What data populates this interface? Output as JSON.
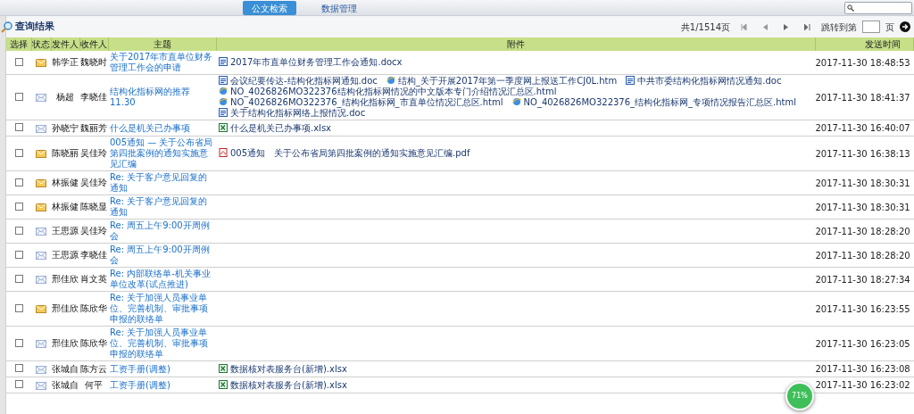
{
  "tabs": [
    {
      "label": "公文检索",
      "selected": true
    },
    {
      "label": "数据管理",
      "selected": false
    }
  ],
  "title": "查询结果",
  "pager": {
    "info": "共1/1514页",
    "jump_label": "跳转到第",
    "page_suffix": "页"
  },
  "table": {
    "columns": [
      "选择",
      "状态",
      "发件人",
      "收件人",
      "主题",
      "附件",
      "发送时间"
    ],
    "rows": [
      {
        "checked": false,
        "unread": true,
        "sender": "韩学正",
        "recipient": "魏晓时",
        "subject": "关于2017年市直单位财务管理工作会的申请",
        "attachments": [
          {
            "kind": "word",
            "name": "2017年市直单位财务管理工作会通知",
            "ext": ".docx"
          }
        ],
        "time": "2017-11-30 18:48:53"
      },
      {
        "checked": false,
        "unread": false,
        "sender": "杨超",
        "recipient": "李晓佳",
        "subject": "结构化指标网的推荐",
        "subject_suffix": "11.30",
        "attachments": [
          {
            "kind": "word",
            "name": "会议纪要传达-结构化指标网通知",
            "ext": ".doc"
          },
          {
            "kind": "web",
            "name": "结构_关于开展2017年第一季度网上报送工作CJ0L",
            "ext": ".htm"
          },
          {
            "kind": "word",
            "name": "中共市委结构化指标网情况通知",
            "ext": ".doc"
          },
          {
            "kind": "web",
            "name": "NO_4026826MO322376结构化指标网情况的中文版本专门介绍情况汇总区",
            "ext": ".html"
          },
          {
            "kind": "web",
            "name": "NO_4026826MO322376_结构化指标网_市直单位情况汇总区",
            "ext": ".html"
          },
          {
            "kind": "web",
            "name": "NO_4026826MO322376_结构化指标网_专项情况报告汇总区",
            "ext": ".html"
          },
          {
            "kind": "word",
            "name": "关于结构化指标网络上报情况",
            "ext": ".doc"
          }
        ],
        "time": "2017-11-30 18:41:37"
      },
      {
        "checked": false,
        "unread": false,
        "sender": "孙晓宁",
        "recipient": "魏丽芳",
        "subject": "什么是机关已办事项",
        "attachments": [
          {
            "kind": "excel",
            "name": "什么是机关已办事项",
            "ext": ".xlsx"
          }
        ],
        "time": "2017-11-30 16:40:07"
      },
      {
        "checked": false,
        "unread": true,
        "sender": "陈晓丽",
        "recipient": "吴佳玲",
        "subject": "005通知 — 关于公布省局第四批案例的通知实施意见汇编",
        "attachments": [
          {
            "kind": "pdf",
            "name": "005通知"
          },
          {
            "kind": "plain",
            "name": "关于公布省局第四批案例的通知实施意见汇编",
            "ext": ".pdf"
          }
        ],
        "time": "2017-11-30 16:38:13"
      },
      {
        "checked": false,
        "unread": true,
        "sender": "林振健",
        "recipient": "吴佳玲",
        "subject_prefix": "Re:",
        "subject": "关于客户意见回复的通知",
        "attachments": [],
        "time": "2017-11-30 18:30:31"
      },
      {
        "checked": false,
        "unread": true,
        "sender": "林振健",
        "recipient": "陈晓显",
        "subject_prefix": "Re:",
        "subject": "关于客户意见回复的通知",
        "attachments": [],
        "time": "2017-11-30 18:30:31"
      },
      {
        "checked": false,
        "unread": false,
        "sender": "王思源",
        "recipient": "吴佳玲",
        "subject_prefix": "Re:",
        "subject": "周五上午9:00开周例会",
        "attachments": [],
        "time": "2017-11-30 18:28:20"
      },
      {
        "checked": false,
        "unread": false,
        "sender": "王思源",
        "recipient": "李晓佳",
        "subject_prefix": "Re:",
        "subject": "周五上午9:00开周例会",
        "attachments": [],
        "time": "2017-11-30 18:28:20"
      },
      {
        "checked": false,
        "unread": false,
        "sender": "邢佳欣",
        "recipient": "肖文英",
        "subject_prefix": "Re:",
        "subject": "内部联络单-机关事业单位改革(试点推进)",
        "attachments": [],
        "time": "2017-11-30 18:27:34"
      },
      {
        "checked": false,
        "unread": true,
        "sender": "邢佳欣",
        "recipient": "陈欣华",
        "subject_prefix": "Re:",
        "subject": "关于加强人员事业单位、完善机制、审批事项申报的联络单",
        "attachments": [],
        "time": "2017-11-30 16:23:55"
      },
      {
        "checked": false,
        "unread": false,
        "sender": "邢佳欣",
        "recipient": "陈欣华",
        "subject_prefix": "Re:",
        "subject": "关于加强人员事业单位、完善机制、审批事项申报的联络单",
        "attachments": [],
        "time": "2017-11-30 16:23:05"
      },
      {
        "checked": false,
        "unread": false,
        "sender": "张城自",
        "recipient": "陈方云",
        "subject": "工资手册(调整)",
        "attachments": [
          {
            "kind": "excel",
            "name": "数据核对表服务台(新增)",
            "ext": ".xlsx"
          }
        ],
        "time": "2017-11-30 16:23:08"
      },
      {
        "checked": false,
        "unread": false,
        "sender": "张城自",
        "recipient": "何平",
        "subject": "工资手册(调整)",
        "attachments": [
          {
            "kind": "excel",
            "name": "数据核对表服务台(新增)",
            "ext": ".xlsx"
          }
        ],
        "time": "2017-11-30 16:23:02"
      }
    ]
  },
  "speed_badge": "71%"
}
